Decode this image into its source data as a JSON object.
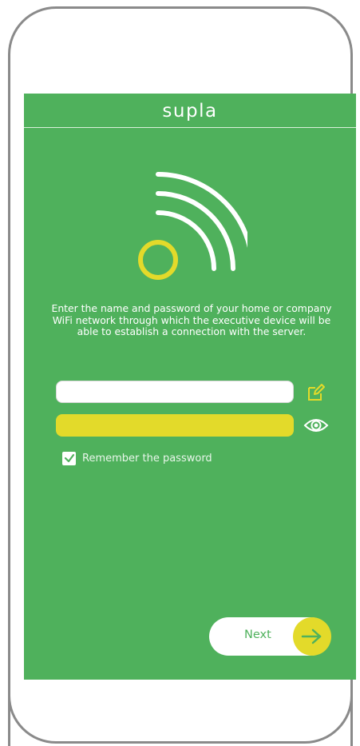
{
  "app": {
    "title": "supla"
  },
  "instructions": {
    "text": "Enter the name and password of your home or company WiFi network through which the executive device will be able to establish a connection with the server."
  },
  "form": {
    "ssid_value": "",
    "password_value": "",
    "remember_label": "Remember the password",
    "remember_checked": true
  },
  "actions": {
    "next_label": "Next"
  },
  "colors": {
    "background": "#4fb15c",
    "accent_yellow": "#e3da2a",
    "white": "#ffffff"
  },
  "icons": {
    "wifi": "wifi-signal-icon",
    "edit": "edit-icon",
    "eye": "eye-icon",
    "check": "check-icon",
    "arrow": "arrow-right-icon"
  }
}
